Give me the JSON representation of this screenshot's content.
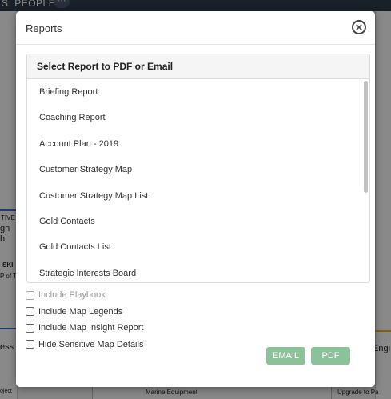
{
  "background": {
    "nav_left": "S",
    "nav_people": "PEOPLE",
    "nav_more": "···",
    "left_labels": [
      "TIVE",
      "gn",
      "h",
      "SKI",
      "P of T",
      "ess",
      "oject"
    ],
    "right_label": "Engi",
    "bottom_left": "Marine Equipment",
    "bottom_right": "Upgrade to Pa"
  },
  "modal": {
    "title": "Reports",
    "close_icon": "close-circle-icon",
    "list_header": "Select Report to PDF or Email",
    "reports": [
      "Briefing Report",
      "Coaching Report",
      "Account Plan - 2019",
      "Customer Strategy Map",
      "Customer Strategy Map List",
      "Gold Contacts",
      "Gold Contacts List",
      "Strategic Interests Board"
    ],
    "options": [
      {
        "label": "Include Playbook",
        "disabled": true
      },
      {
        "label": "Include Map Legends",
        "disabled": false
      },
      {
        "label": "Include Map Insight Report",
        "disabled": false
      },
      {
        "label": "Hide Sensitive Map Details",
        "disabled": false
      }
    ],
    "email_label": "EMAIL",
    "pdf_label": "PDF",
    "accent": "#8cc29a"
  }
}
